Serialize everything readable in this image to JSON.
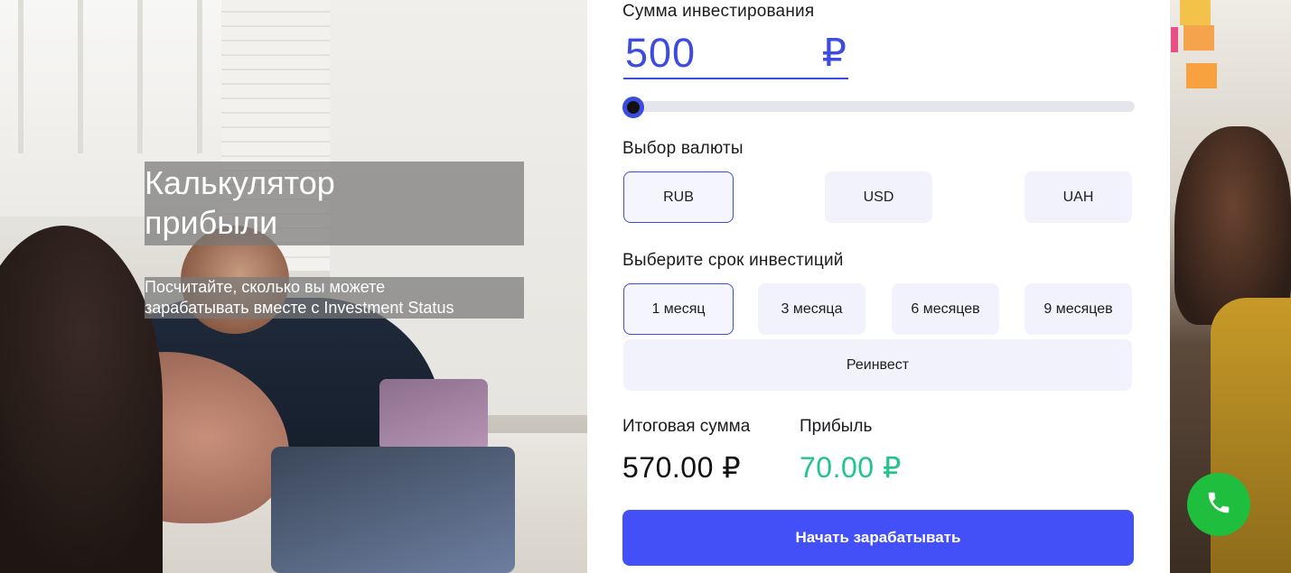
{
  "hero": {
    "title": "Калькулятор\nприбыли",
    "subtitle": "Посчитайте, сколько вы можете\nзарабатывать вместе с Investment Status"
  },
  "calculator": {
    "amount_label": "Сумма инвестирования",
    "amount_value": "500",
    "amount_currency_sign": "₽",
    "slider_level": 0.0,
    "currency_label": "Выбор валюты",
    "currencies": [
      {
        "label": "RUB",
        "active": true
      },
      {
        "label": "USD",
        "active": false
      },
      {
        "label": "UAH",
        "active": false
      }
    ],
    "term_label": "Выберите срок инвестиций",
    "terms": [
      {
        "label": "1 месяц",
        "active": true
      },
      {
        "label": "3 месяца",
        "active": false
      },
      {
        "label": "6 месяцев",
        "active": false
      },
      {
        "label": "9 месяцев",
        "active": false
      }
    ],
    "reinvest_label": "Реинвест",
    "total_label": "Итоговая сумма",
    "total_value": "570.00 ₽",
    "profit_label": "Прибыль",
    "profit_value": "70.00 ₽",
    "cta_label": "Начать зарабатывать"
  },
  "call_button": {
    "icon": "phone-icon"
  },
  "colors": {
    "accent": "#4350f8",
    "profit_green": "#21c48a",
    "call_green": "#1fbe3f"
  }
}
